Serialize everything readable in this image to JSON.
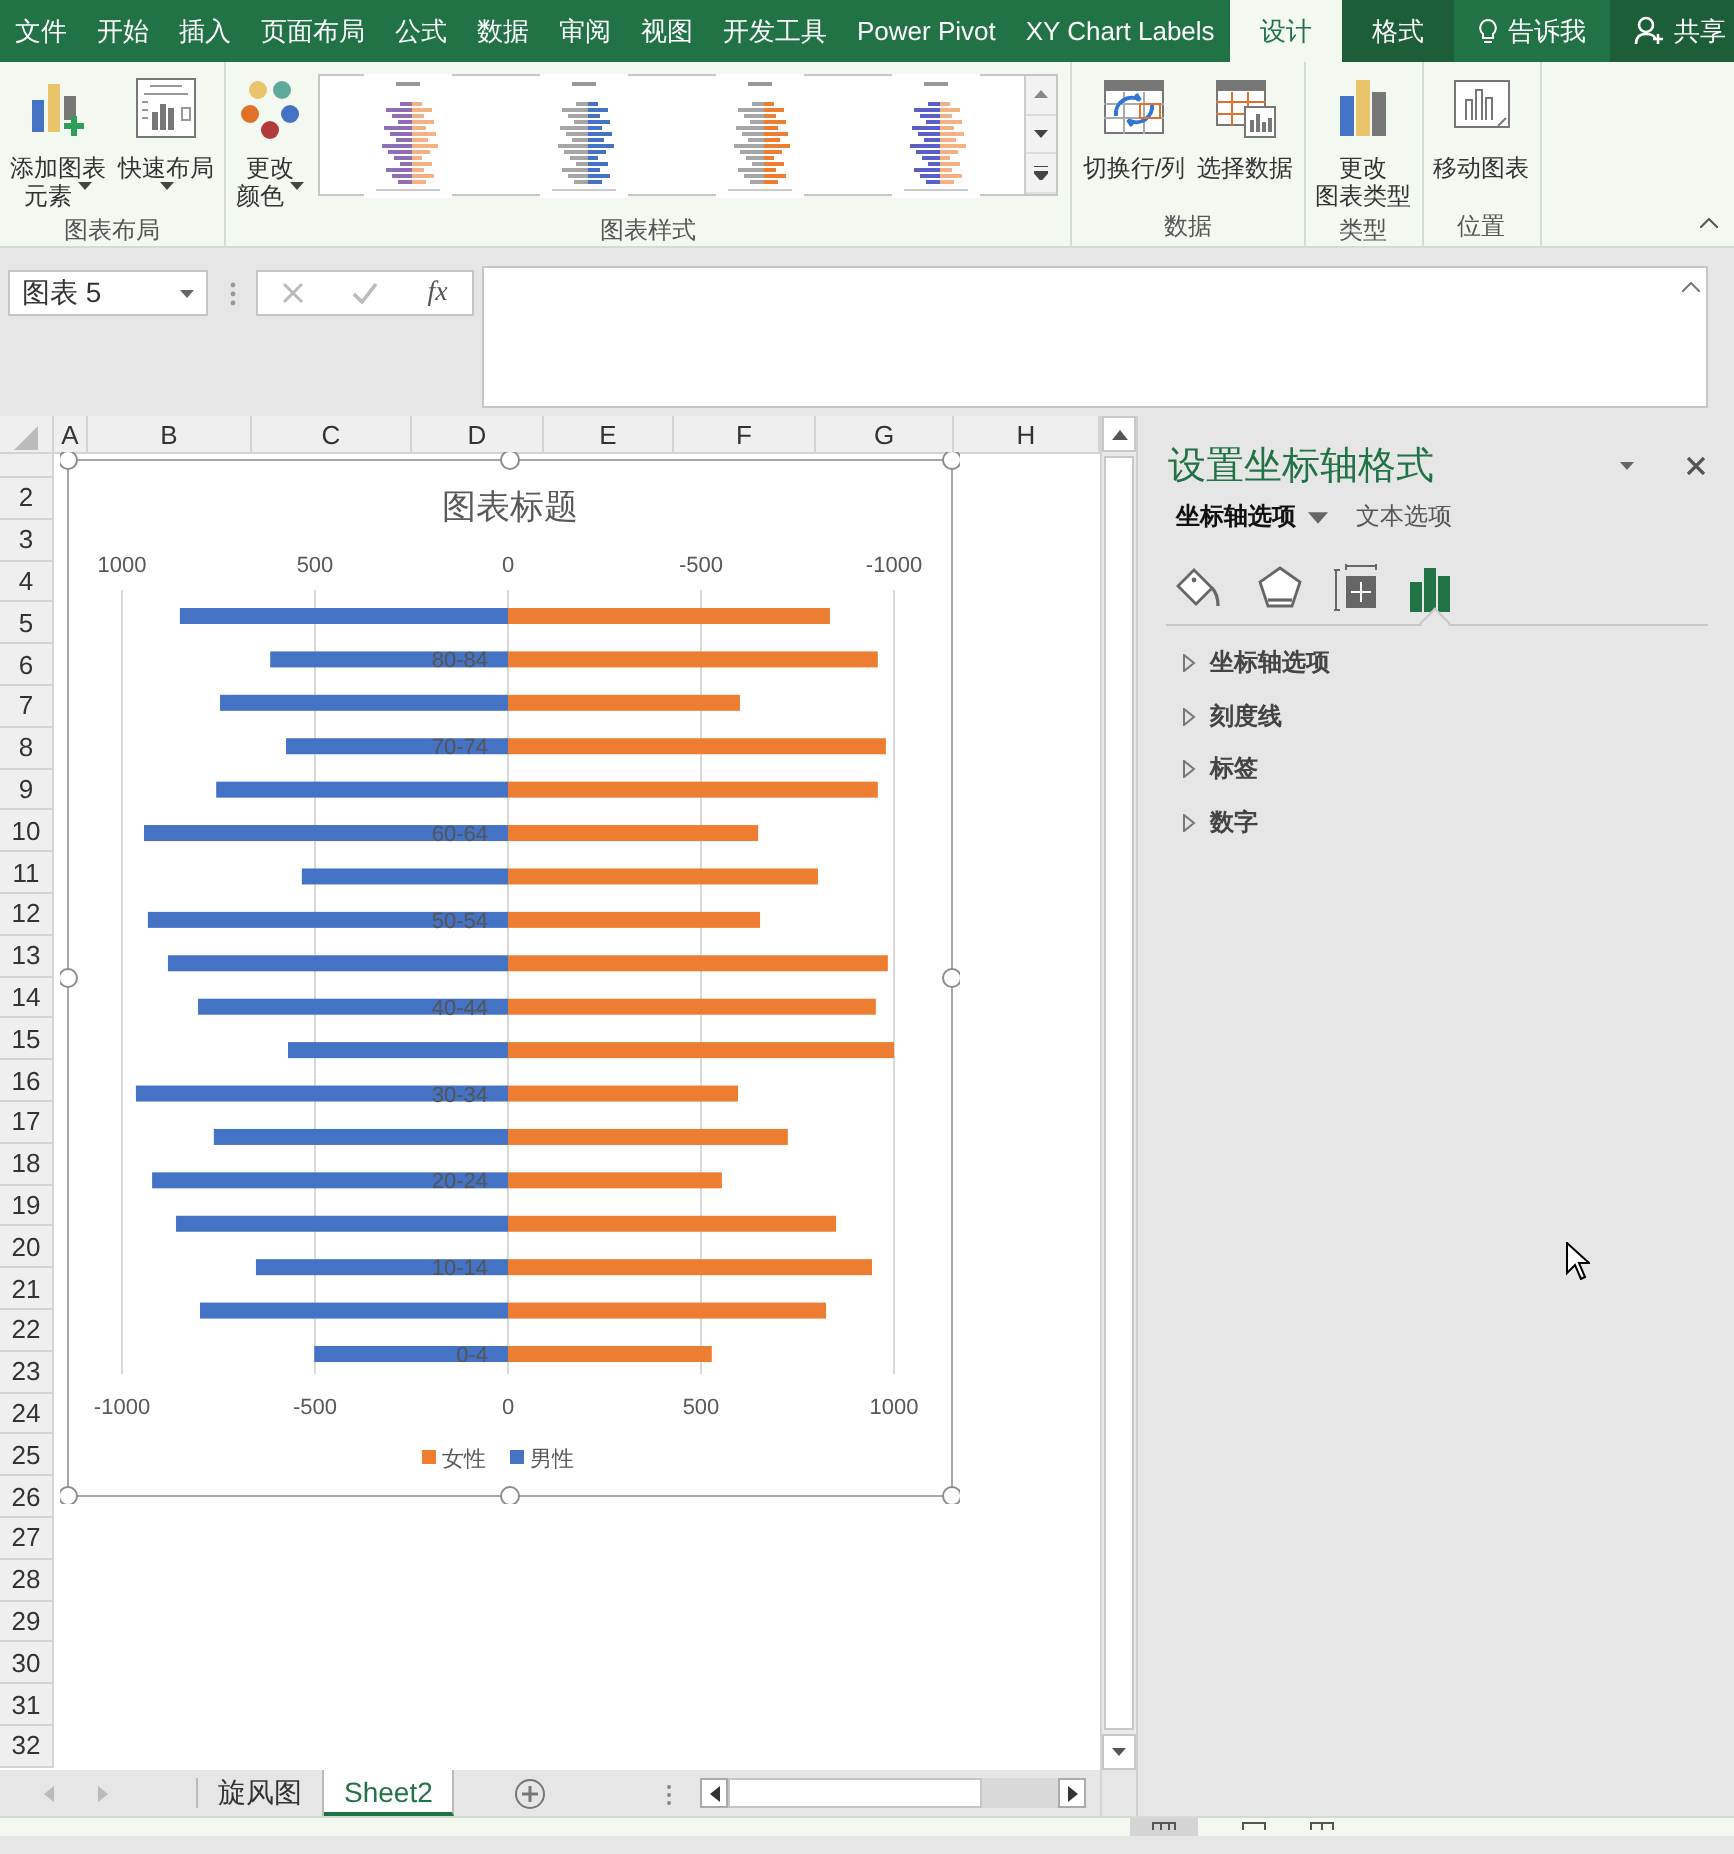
{
  "ribbon_tabs": [
    {
      "label": "文件",
      "selected": false,
      "contextual": false
    },
    {
      "label": "开始",
      "selected": false,
      "contextual": false
    },
    {
      "label": "插入",
      "selected": false,
      "contextual": false
    },
    {
      "label": "页面布局",
      "selected": false,
      "contextual": false
    },
    {
      "label": "公式",
      "selected": false,
      "contextual": false
    },
    {
      "label": "数据",
      "selected": false,
      "contextual": false
    },
    {
      "label": "审阅",
      "selected": false,
      "contextual": false
    },
    {
      "label": "视图",
      "selected": false,
      "contextual": false
    },
    {
      "label": "开发工具",
      "selected": false,
      "contextual": false
    },
    {
      "label": "Power Pivot",
      "selected": false,
      "contextual": false
    },
    {
      "label": "XY Chart Labels",
      "selected": false,
      "contextual": false
    },
    {
      "label": "设计",
      "selected": true,
      "contextual": true
    },
    {
      "label": "格式",
      "selected": false,
      "contextual": true
    }
  ],
  "tell_me": "告诉我",
  "share": "共享",
  "ribbon_groups": [
    {
      "label": "图表布局",
      "buttons": [
        {
          "kind": "add-element",
          "lines": [
            "添加图表",
            "元素"
          ],
          "menu": true
        },
        {
          "kind": "quick-layout",
          "lines": [
            "快速布局"
          ],
          "menu": true
        }
      ]
    },
    {
      "label": "图表样式",
      "buttons": [
        {
          "kind": "colors",
          "lines": [
            "更改",
            "颜色"
          ],
          "menu": true
        },
        {
          "kind": "gallery"
        }
      ]
    },
    {
      "label": "数据",
      "buttons": [
        {
          "kind": "switch",
          "lines": [
            "切换行/列"
          ],
          "menu": false
        },
        {
          "kind": "select-data",
          "lines": [
            "选择数据"
          ],
          "menu": false
        }
      ]
    },
    {
      "label": "类型",
      "buttons": [
        {
          "kind": "change-type",
          "lines": [
            "更改",
            "图表类型"
          ],
          "menu": false
        }
      ]
    },
    {
      "label": "位置",
      "buttons": [
        {
          "kind": "move",
          "lines": [
            "移动图表"
          ],
          "menu": false
        }
      ]
    }
  ],
  "formula_bar": {
    "name_box": "图表 5",
    "function_button": "fx"
  },
  "sheet": {
    "columns": [
      "A",
      "B",
      "C",
      "D",
      "E",
      "F",
      "G",
      "H"
    ],
    "rows": [
      "2",
      "3",
      "4",
      "5",
      "6",
      "7",
      "8",
      "9",
      "10",
      "11",
      "12",
      "13",
      "14",
      "15",
      "16",
      "17",
      "18",
      "19",
      "20",
      "21",
      "22",
      "23",
      "24",
      "25",
      "26",
      "27",
      "28",
      "29",
      "30",
      "31",
      "32"
    ]
  },
  "chart": {
    "top_axis_labels": [
      "1000",
      "500",
      "0",
      "-500",
      "-1000"
    ],
    "chart_data": {
      "type": "bar",
      "orientation": "horizontal",
      "title": "图表标题",
      "categories": [
        null,
        "80-84",
        null,
        "70-74",
        null,
        "60-64",
        null,
        "50-54",
        null,
        "40-44",
        null,
        "30-34",
        null,
        "20-24",
        null,
        "10-14",
        null,
        "0-4"
      ],
      "series": [
        {
          "name": "女性",
          "color": "#ed7d31",
          "values": [
            834,
            958,
            601,
            979,
            958,
            648,
            803,
            653,
            984,
            953,
            1000,
            596,
            725,
            554,
            850,
            943,
            824,
            528
          ]
        },
        {
          "name": "男性",
          "color": "#4472c4",
          "values": [
            -850,
            -616,
            -746,
            -575,
            -756,
            -943,
            -534,
            -933,
            -881,
            -803,
            -570,
            -964,
            -762,
            -922,
            -860,
            -653,
            -798,
            -502
          ]
        }
      ],
      "xlim": [
        -1000,
        1000
      ],
      "xticks": [
        {
          "value": -1000,
          "label": "-1000"
        },
        {
          "value": -500,
          "label": "-500"
        },
        {
          "value": 0,
          "label": "0"
        },
        {
          "value": 500,
          "label": "500"
        },
        {
          "value": 1000,
          "label": "1000"
        }
      ],
      "stacked": true,
      "grid": true,
      "legend": true
    }
  },
  "pane": {
    "title": "设置坐标轴格式",
    "tabs": [
      {
        "label": "坐标轴选项",
        "selected": true,
        "menu": true
      },
      {
        "label": "文本选项",
        "selected": false,
        "menu": false
      }
    ],
    "icon_tabs": [
      {
        "kind": "fill",
        "selected": false
      },
      {
        "kind": "effects",
        "selected": false
      },
      {
        "kind": "size",
        "selected": false
      },
      {
        "kind": "options",
        "selected": true
      }
    ],
    "sections": [
      {
        "label": "坐标轴选项",
        "expanded": false
      },
      {
        "label": "刻度线",
        "expanded": false
      },
      {
        "label": "标签",
        "expanded": false
      },
      {
        "label": "数字",
        "expanded": false
      }
    ]
  },
  "sheet_tabs": [
    {
      "label": "旋风图",
      "selected": false
    },
    {
      "label": "Sheet2",
      "selected": true
    }
  ]
}
